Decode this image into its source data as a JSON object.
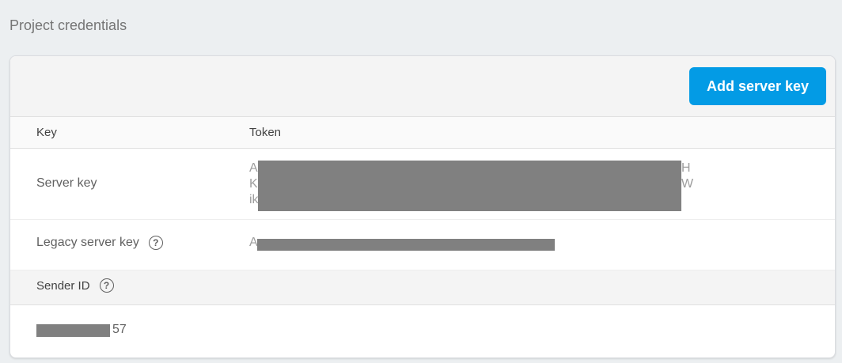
{
  "section_title": "Project credentials",
  "toolbar": {
    "add_button_label": "Add server key"
  },
  "table": {
    "headers": {
      "key": "Key",
      "token": "Token"
    },
    "rows": [
      {
        "key": "Server key",
        "token_lines": [
          {
            "start": "A",
            "end": "H"
          },
          {
            "start": "K",
            "end": "W"
          },
          {
            "start": "ik",
            "end": ""
          }
        ]
      },
      {
        "key": "Legacy server key",
        "token": "A"
      }
    ]
  },
  "sender": {
    "label": "Sender ID",
    "value_suffix": "57"
  },
  "icons": {
    "help": "help-circle-icon"
  },
  "colors": {
    "accent": "#039be5",
    "redaction": "#808080",
    "background": "#eceff1"
  }
}
